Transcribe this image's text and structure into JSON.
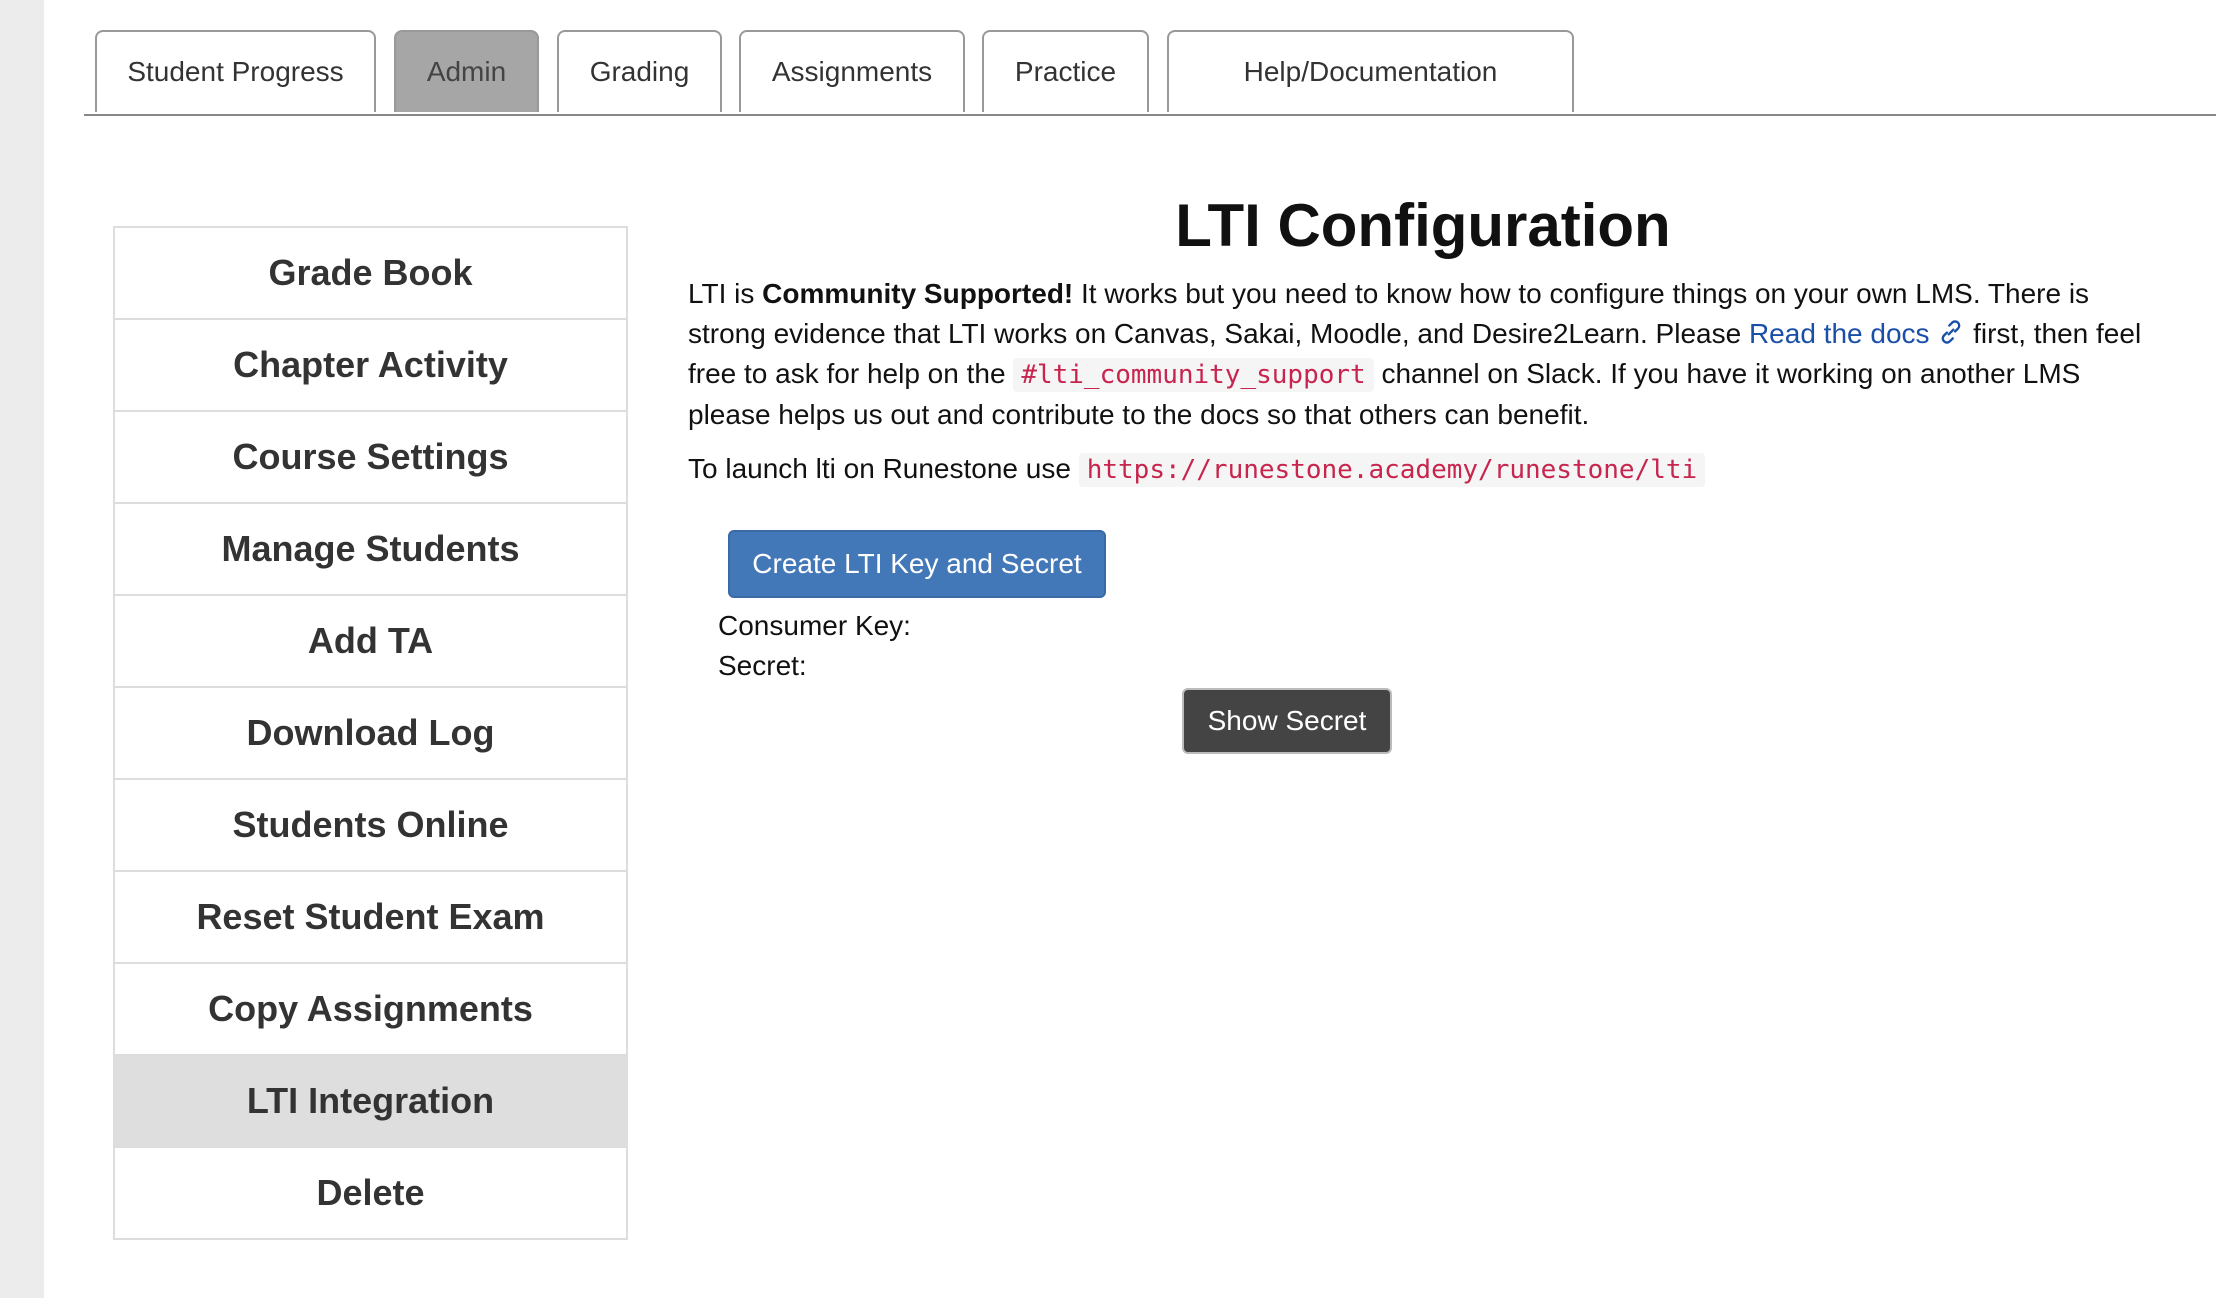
{
  "tabs": [
    {
      "label": "Student Progress",
      "active": false
    },
    {
      "label": "Admin",
      "active": true
    },
    {
      "label": "Grading",
      "active": false
    },
    {
      "label": "Assignments",
      "active": false
    },
    {
      "label": "Practice",
      "active": false
    },
    {
      "label": "Help/Documentation",
      "active": false
    }
  ],
  "sidebar": {
    "items": [
      {
        "label": "Grade Book"
      },
      {
        "label": "Chapter Activity"
      },
      {
        "label": "Course Settings"
      },
      {
        "label": "Manage Students"
      },
      {
        "label": "Add TA"
      },
      {
        "label": "Download Log"
      },
      {
        "label": "Students Online"
      },
      {
        "label": "Reset Student Exam"
      },
      {
        "label": "Copy Assignments"
      },
      {
        "label": "LTI Integration",
        "active": true
      },
      {
        "label": "Delete"
      }
    ]
  },
  "main": {
    "title": "LTI Configuration",
    "intro": {
      "p1": "LTI is ",
      "bold": "Community Supported!",
      "p2": " It works but you need to know how to configure things on your own LMS. There is strong evidence that LTI works on Canvas, Sakai, Moodle, and Desire2Learn. Please ",
      "link": "Read the docs",
      "p3": " first, then feel free to ask for help on the ",
      "code": "#lti_community_support",
      "p4": " channel on Slack. If you have it working on another LMS please helps us out and contribute to the docs so that others can benefit."
    },
    "launch_text": "To launch lti on Runestone use ",
    "launch_url": "https://runestone.academy/runestone/lti",
    "create_button": "Create LTI Key and Secret",
    "consumer_key_label": "Consumer Key:",
    "secret_label": "Secret:",
    "show_secret_button": "Show Secret"
  },
  "icons": {
    "link_icon": "link-icon"
  },
  "colors": {
    "primary": "#4378b8",
    "link": "#1a4fa8",
    "code": "#c7254e",
    "active_tab": "#a6a6a6",
    "active_sidebar": "#dedede"
  }
}
